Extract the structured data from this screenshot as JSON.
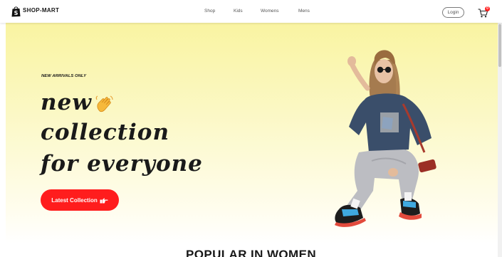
{
  "brand": {
    "name": "SHOP-MART",
    "logo_icon": "shopping-bag-icon"
  },
  "nav": {
    "items": [
      {
        "label": "Shop"
      },
      {
        "label": "Kids"
      },
      {
        "label": "Womens"
      },
      {
        "label": "Mens"
      }
    ]
  },
  "header": {
    "login_label": "Login",
    "cart_icon": "cart-icon",
    "cart_count": "0"
  },
  "hero": {
    "tagline": "NEW ARRIVALS ONLY",
    "headline_lines": [
      "new",
      "collection",
      "for everyone"
    ],
    "wave_icon": "waving-hand-icon",
    "cta_label": "Latest Collection",
    "cta_icon": "pointing-hand-icon"
  },
  "section": {
    "title": "POPULAR IN WOMEN"
  },
  "colors": {
    "accent": "#ff1d1d",
    "hero_gradient_top": "#f9f4a1",
    "hero_gradient_bottom": "#ffffff",
    "text": "#171717"
  }
}
